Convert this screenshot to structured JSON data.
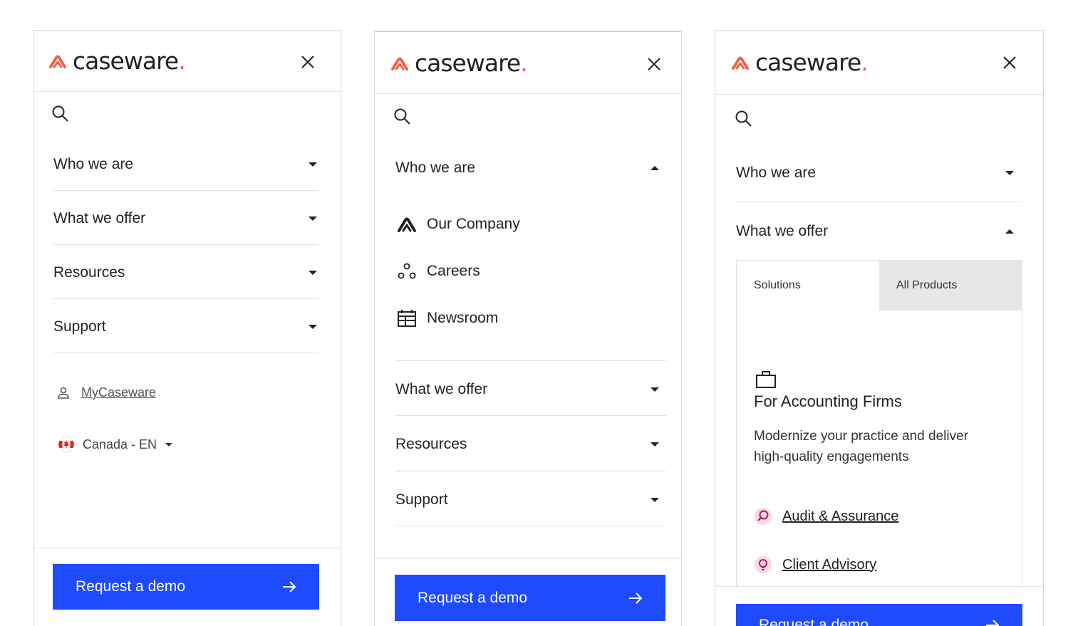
{
  "brand": {
    "name": "caseware",
    "dot": ".",
    "accent": "#f0614d",
    "button_blue": "#1f4bff"
  },
  "panel1": {
    "nav": [
      {
        "label": "Who we are",
        "state": "collapsed"
      },
      {
        "label": "What we offer",
        "state": "collapsed"
      },
      {
        "label": "Resources",
        "state": "collapsed"
      },
      {
        "label": "Support",
        "state": "collapsed"
      }
    ],
    "mycaseware_label": "MyCaseware",
    "language_label": "Canada - EN",
    "demo_label": "Request a demo"
  },
  "panel2": {
    "nav_open": {
      "label": "Who we are",
      "state": "expanded"
    },
    "sub_items": [
      {
        "label": "Our Company",
        "icon": "caseware-logo-icon"
      },
      {
        "label": "Careers",
        "icon": "people-dots-icon"
      },
      {
        "label": "Newsroom",
        "icon": "calendar-icon"
      }
    ],
    "nav": [
      {
        "label": "What we offer",
        "state": "collapsed"
      },
      {
        "label": "Resources",
        "state": "collapsed"
      },
      {
        "label": "Support",
        "state": "collapsed"
      }
    ],
    "demo_label": "Request a demo"
  },
  "panel3": {
    "nav": [
      {
        "label": "Who we are",
        "state": "collapsed"
      },
      {
        "label": "What we offer",
        "state": "expanded"
      }
    ],
    "tabs": [
      {
        "label": "Solutions",
        "active": true
      },
      {
        "label": "All Products",
        "active": false
      }
    ],
    "feature": {
      "icon": "briefcase-icon",
      "title": "For Accounting Firms",
      "description": "Modernize your practice and deliver high-quality engagements"
    },
    "products": [
      {
        "label": "Audit & Assurance",
        "icon": "audit-magnifier-icon"
      },
      {
        "label": "Client Advisory",
        "icon": "lightbulb-icon"
      }
    ],
    "demo_label": "Request a demo"
  }
}
